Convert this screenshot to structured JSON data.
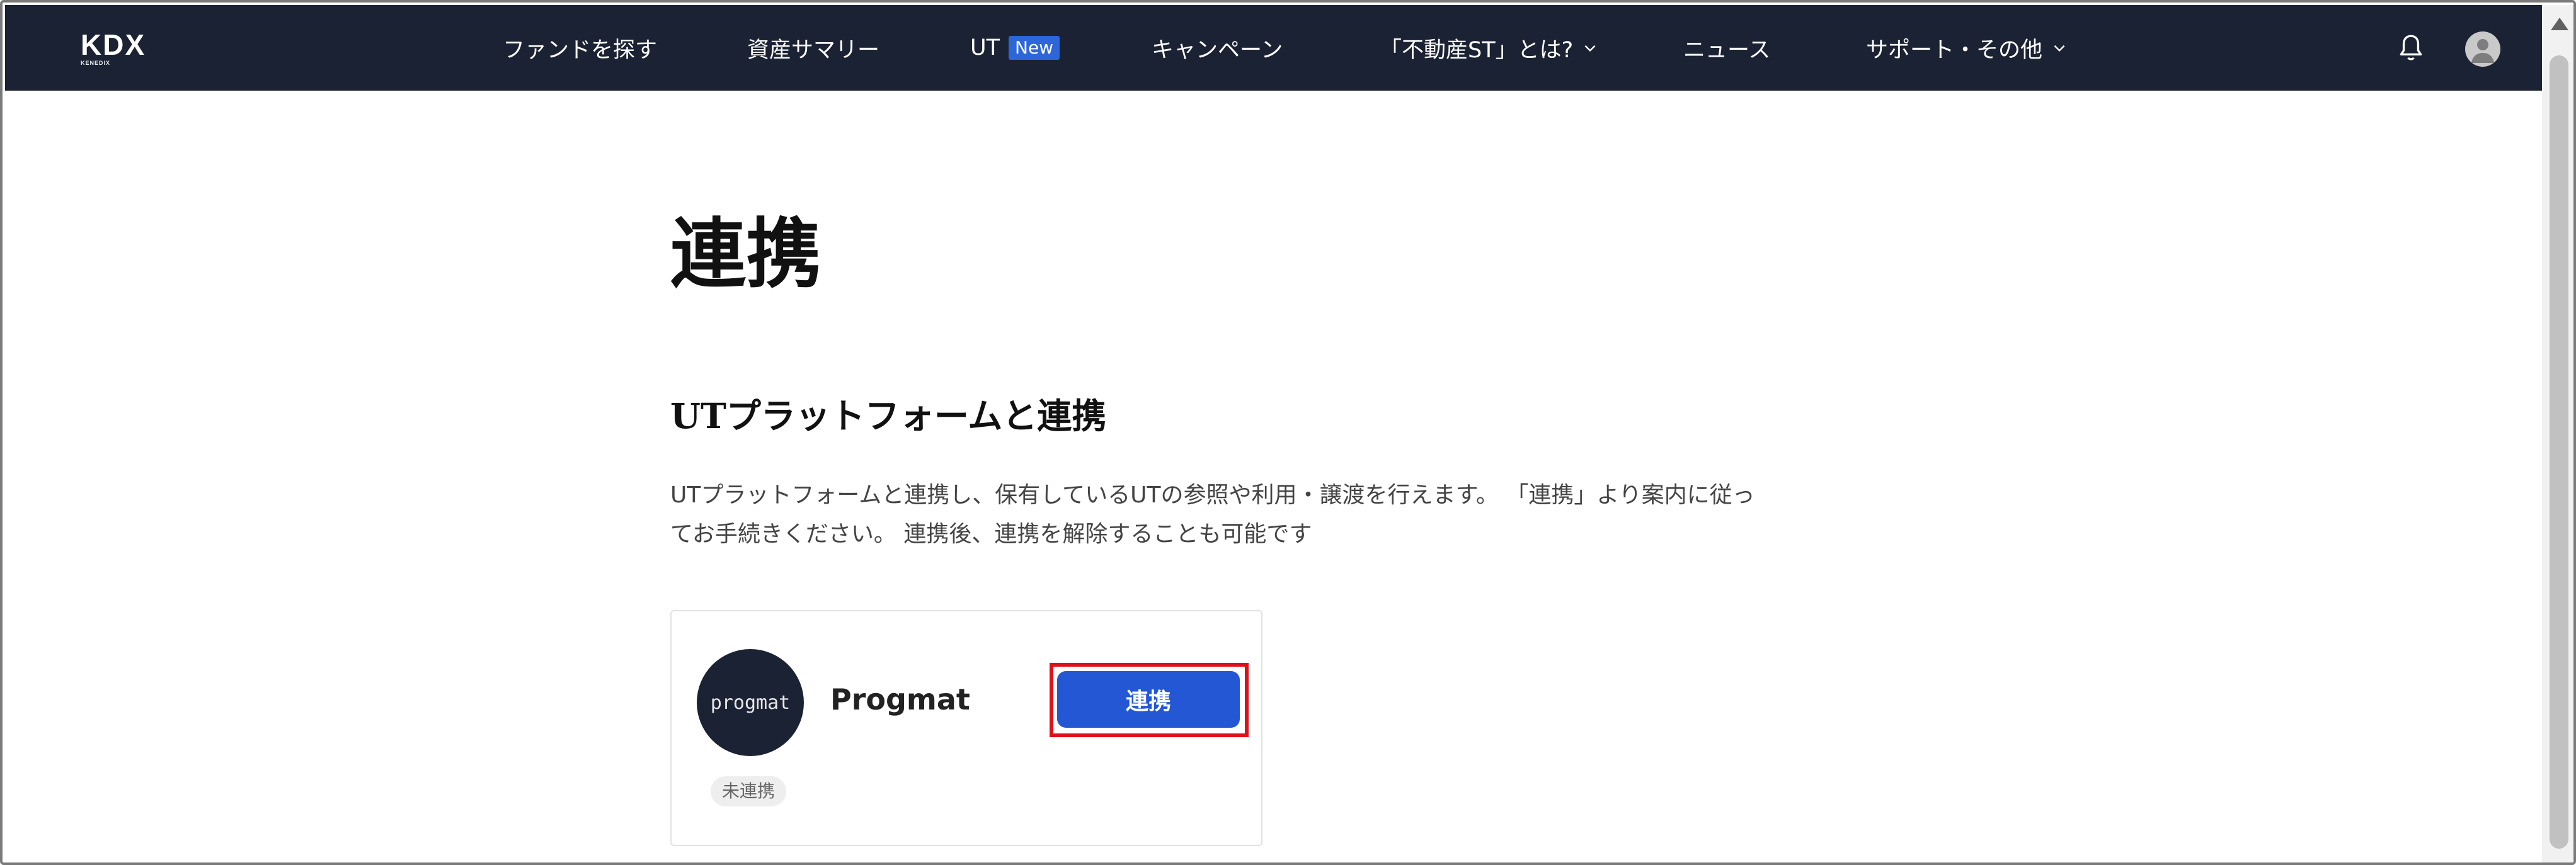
{
  "header": {
    "logo": "KDX",
    "logo_sub": "KENEDIX",
    "nav": [
      {
        "label": "ファンドを探す"
      },
      {
        "label": "資産サマリー"
      },
      {
        "label": "UT",
        "badge": "New"
      },
      {
        "label": "キャンペーン"
      },
      {
        "label": "「不動産ST」とは?",
        "icon": "chevron-down-icon"
      },
      {
        "label": "ニュース"
      },
      {
        "label": "サポート・その他",
        "icon": "chevron-down-icon"
      }
    ],
    "icons": {
      "notification": "bell-icon",
      "user": "avatar-icon"
    },
    "background_color": "#1b2233",
    "badge_color": "#2d66d9"
  },
  "page": {
    "title": "連携",
    "section_title": "UTプラットフォームと連携",
    "description_line1": "UTプラットフォームと連携し、保有しているUTの参照や利用・譲渡を行えます。 「連携」より案内に従っ",
    "description_line2": "てお手続きください。 連携後、連携を解除することも可能です"
  },
  "card": {
    "logo_text": "progmat",
    "name": "Progmat",
    "status": "未連携",
    "button_label": "連携",
    "button_color": "#2357d3",
    "highlight_color": "#e0101a"
  }
}
